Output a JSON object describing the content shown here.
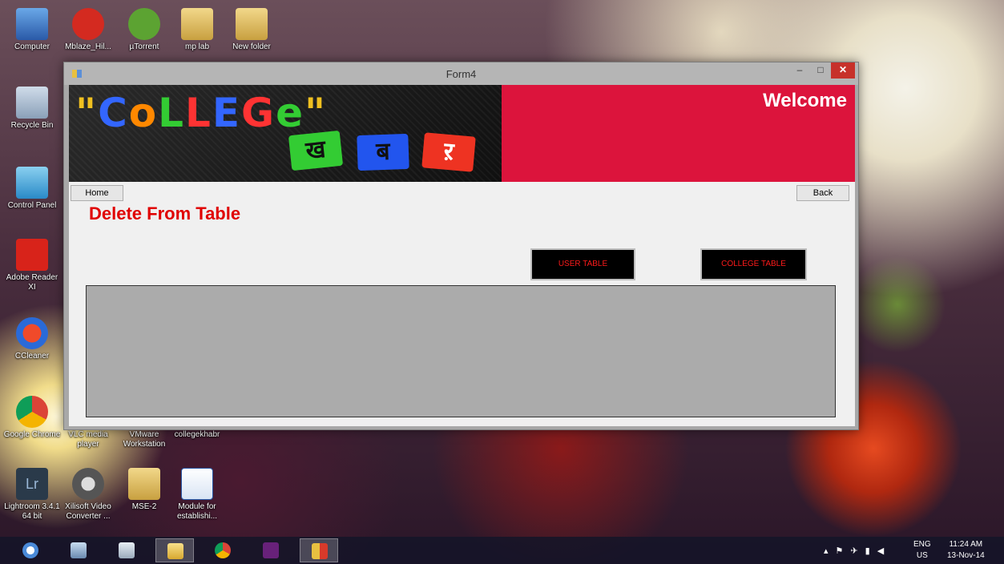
{
  "desktop": {
    "icons": [
      {
        "label": "Computer"
      },
      {
        "label": "Mblaze_Hil..."
      },
      {
        "label": "µTorrent"
      },
      {
        "label": "mp lab"
      },
      {
        "label": "New folder"
      },
      {
        "label": "Recycle Bin"
      },
      {
        "label": "Control Panel"
      },
      {
        "label": "Adobe Reader XI"
      },
      {
        "label": "CCleaner"
      },
      {
        "label": "Google Chrome"
      },
      {
        "label": "VLC media player"
      },
      {
        "label": "VMware Workstation"
      },
      {
        "label": "collegekhabr"
      },
      {
        "label": "Lightroom 3.4.1 64 bit"
      },
      {
        "label": "Xilisoft Video Converter ..."
      },
      {
        "label": "MSE-2"
      },
      {
        "label": "Module for establishi..."
      }
    ]
  },
  "window": {
    "title": "Form4",
    "minimize": "–",
    "maximize": "□",
    "close": "✕"
  },
  "banner": {
    "logo": "\"CoLLEGe\"",
    "tiles": [
      "ख",
      "ब",
      "ऱ"
    ],
    "welcome": "Welcome"
  },
  "form": {
    "home_label": "Home",
    "back_label": "Back",
    "heading": "Delete From Table",
    "user_table_label": "USER TABLE",
    "college_table_label": "COLLEGE TABLE"
  },
  "taskbar": {
    "apps": [
      {
        "icon": "search-icon"
      },
      {
        "icon": "photos-icon"
      },
      {
        "icon": "calculator-icon"
      },
      {
        "icon": "file-explorer-icon"
      },
      {
        "icon": "chrome-icon"
      },
      {
        "icon": "visual-studio-icon"
      },
      {
        "icon": "form-app-icon"
      }
    ],
    "language": "ENG",
    "region": "US",
    "time": "11:24 AM",
    "date": "13-Nov-14"
  },
  "colors": {
    "banner_red": "#dc143c",
    "heading_red": "#e00000",
    "button_text_red": "#ff1a1a"
  }
}
